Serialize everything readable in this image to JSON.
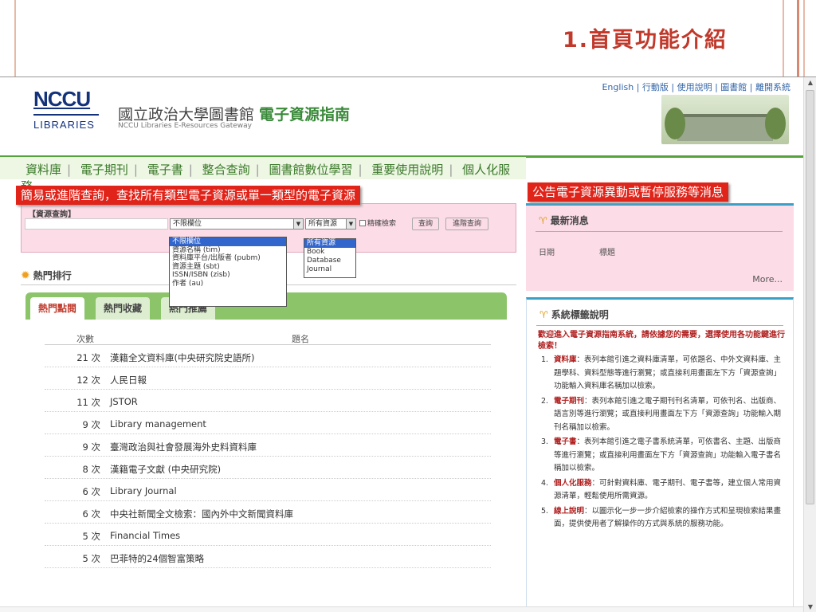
{
  "slide": {
    "title": "1.首頁功能介紹"
  },
  "header": {
    "logo_top": "NCCU",
    "logo_bottom": "LIBRARIES",
    "site_title_main": "國立政治大學圖書館 ",
    "site_title_bold": "電子資源指南",
    "site_subtitle": "NCCU Libraries E-Resources Gateway",
    "top_links": "English | 行動版 | 使用說明 | 圖書館 | 離開系統"
  },
  "nav": {
    "items": [
      "資料庫",
      "電子期刊",
      "電子書",
      "整合查詢",
      "圖書館數位學習",
      "重要使用說明",
      "個人化服務"
    ],
    "separator": "|"
  },
  "annotations": {
    "search": "簡易或進階查詢，查找所有類型電子資源或單一類型的電子資源",
    "news": "公告電子資源異動或暫停服務等消息"
  },
  "search": {
    "heading": "【資源查詢】",
    "field_selected": "不限欄位",
    "type_selected": "所有資源",
    "exact_label": "精確檢索",
    "search_button": "查詢",
    "advanced_button": "進階查詢",
    "field_options": [
      "不限欄位",
      "資源名稱 (tim)",
      "資料庫平台/出版者 (pubm)",
      "資源主題 (sbt)",
      "ISSN/ISBN (zisb)",
      "作者 (au)"
    ],
    "type_options": [
      "所有資源",
      "Book",
      "Database",
      "Journal"
    ]
  },
  "hot": {
    "heading": "熱門排行",
    "tabs": [
      "熱門點閱",
      "熱門收藏",
      "熱門推薦"
    ],
    "col_count": "次數",
    "col_title": "題名",
    "rows": [
      {
        "count": "21 次",
        "title": "漢籍全文資料庫(中央研究院史語所)"
      },
      {
        "count": "12 次",
        "title": "人民日報"
      },
      {
        "count": "11 次",
        "title": "JSTOR"
      },
      {
        "count": "9 次",
        "title": "Library management"
      },
      {
        "count": "9 次",
        "title": "臺灣政治與社會發展海外史料資料庫"
      },
      {
        "count": "8 次",
        "title": "漢籍電子文獻 (中央研究院)"
      },
      {
        "count": "6 次",
        "title": "Library Journal"
      },
      {
        "count": "6 次",
        "title": "中央社新聞全文檢索：國內外中文新聞資料庫"
      },
      {
        "count": "5 次",
        "title": "Financial Times"
      },
      {
        "count": "5 次",
        "title": "巴菲特的24個智富策略"
      }
    ]
  },
  "news": {
    "heading": "最新消息",
    "col_date": "日期",
    "col_title": "標題",
    "more": "More..."
  },
  "system": {
    "heading": "系統標籤說明",
    "intro": "歡迎進入電子資源指南系統，請依據您的需要，選擇使用各功能鍵進行檢索！",
    "items": [
      {
        "num": "1.",
        "name": "資料庫",
        "text": "：表列本館引進之資料庫清單，可依題名、中外文資料庫、主題學科、資料型態等進行瀏覽；或直接利用畫面左下方「資源查詢」功能輸入資料庫名稱加以檢索。"
      },
      {
        "num": "2.",
        "name": "電子期刊",
        "text": "：表列本館引進之電子期刊刊名清單，可依刊名、出版商、語言別等進行瀏覽；或直接利用畫面左下方「資源查詢」功能輸入期刊名稱加以檢索。"
      },
      {
        "num": "3.",
        "name": "電子書",
        "text": "：表列本館引進之電子書系統清單，可依書名、主題、出版商等進行瀏覽；或直接利用畫面左下方「資源查詢」功能輸入電子書名稱加以檢索。"
      },
      {
        "num": "4.",
        "name": "個人化服務",
        "text": "：可針對資料庫、電子期刊、電子書等，建立個人常用資源清單，輕鬆使用所需資源。"
      },
      {
        "num": "5.",
        "name": "線上說明",
        "text": "：以圖示化一步一步介紹檢索的操作方式和呈現檢索結果畫面，提供使用者了解操作的方式與系統的服務功能。"
      }
    ]
  }
}
